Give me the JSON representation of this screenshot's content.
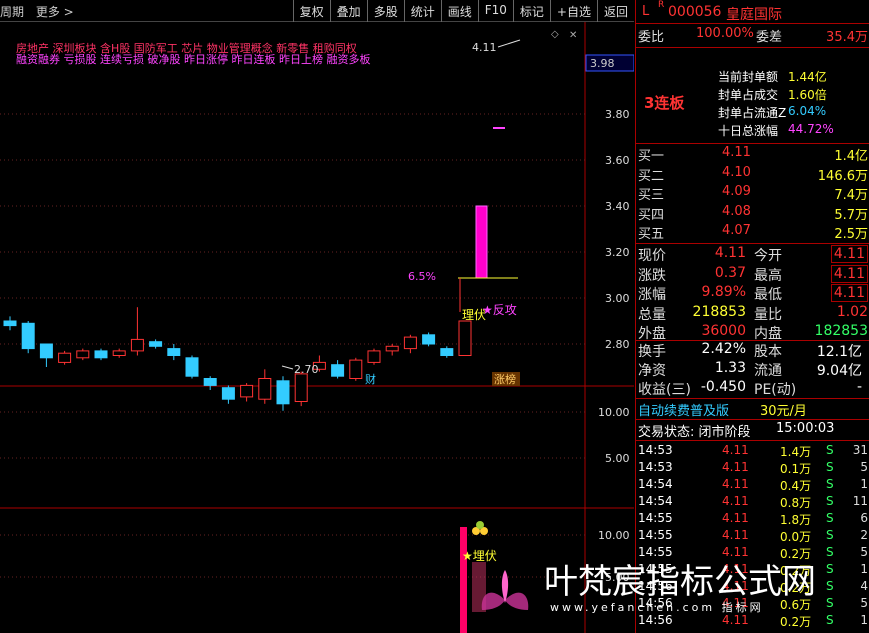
{
  "toolbar": {
    "left_items": [
      "周期",
      "更多 >"
    ],
    "buttons": [
      "复权",
      "叠加",
      "多股",
      "统计",
      "画线",
      "F10",
      "标记",
      "+自选",
      "返回"
    ]
  },
  "chart": {
    "concepts_line1": "房地产   深圳板块 含H股 国防军工 芯片 物业管理概念 新零售 租购同权",
    "concepts_line2": "融资融券 亏损股 连续亏损 破净股 昨日涨停 昨日连板 昨日上榜 融资多板",
    "price_scale": [
      "3.98",
      "3.80",
      "3.60",
      "3.40",
      "3.20",
      "3.00",
      "2.80"
    ],
    "high_label": "4.11",
    "low_label": "2.70",
    "pct_label": "6.5%",
    "signal_buy": "理伏",
    "signal_fangong": "★反攻",
    "tag_cai": "财",
    "tag_zhangbang": "涨榜",
    "vol_scale": [
      "10.00",
      "5.00"
    ],
    "ind_scale": [
      "10.00",
      "5.00"
    ],
    "ind_signal": "★埋伏",
    "candles": [
      {
        "o": 3.1,
        "c": 3.08,
        "h": 3.12,
        "l": 3.06
      },
      {
        "o": 3.09,
        "c": 2.98,
        "h": 3.1,
        "l": 2.96
      },
      {
        "o": 3.0,
        "c": 2.94,
        "h": 3.0,
        "l": 2.9
      },
      {
        "o": 2.92,
        "c": 2.96,
        "h": 2.97,
        "l": 2.91
      },
      {
        "o": 2.94,
        "c": 2.97,
        "h": 2.98,
        "l": 2.93
      },
      {
        "o": 2.97,
        "c": 2.94,
        "h": 2.98,
        "l": 2.93
      },
      {
        "o": 2.95,
        "c": 2.97,
        "h": 2.98,
        "l": 2.94
      },
      {
        "o": 2.97,
        "c": 3.02,
        "h": 3.16,
        "l": 2.95
      },
      {
        "o": 3.01,
        "c": 2.99,
        "h": 3.02,
        "l": 2.98
      },
      {
        "o": 2.98,
        "c": 2.95,
        "h": 3.0,
        "l": 2.93
      },
      {
        "o": 2.94,
        "c": 2.86,
        "h": 2.95,
        "l": 2.85
      },
      {
        "o": 2.85,
        "c": 2.82,
        "h": 2.86,
        "l": 2.8
      },
      {
        "o": 2.81,
        "c": 2.76,
        "h": 2.82,
        "l": 2.74
      },
      {
        "o": 2.77,
        "c": 2.82,
        "h": 2.83,
        "l": 2.75
      },
      {
        "o": 2.76,
        "c": 2.85,
        "h": 2.89,
        "l": 2.74
      },
      {
        "o": 2.84,
        "c": 2.74,
        "h": 2.86,
        "l": 2.71
      },
      {
        "o": 2.75,
        "c": 2.87,
        "h": 2.88,
        "l": 2.73
      },
      {
        "o": 2.89,
        "c": 2.92,
        "h": 2.95,
        "l": 2.88
      },
      {
        "o": 2.91,
        "c": 2.86,
        "h": 2.93,
        "l": 2.85
      },
      {
        "o": 2.85,
        "c": 2.93,
        "h": 2.94,
        "l": 2.84
      },
      {
        "o": 2.92,
        "c": 2.97,
        "h": 2.98,
        "l": 2.91
      },
      {
        "o": 2.97,
        "c": 2.99,
        "h": 3.0,
        "l": 2.95
      },
      {
        "o": 2.98,
        "c": 3.03,
        "h": 3.04,
        "l": 2.96
      },
      {
        "o": 3.04,
        "c": 3.0,
        "h": 3.05,
        "l": 2.99
      },
      {
        "o": 2.98,
        "c": 2.95,
        "h": 2.99,
        "l": 2.94
      },
      {
        "o": 2.95,
        "c": 3.1,
        "h": 3.1,
        "l": 2.95
      },
      {
        "o": 3.1,
        "c": 3.4,
        "h": 3.4,
        "l": 3.1
      }
    ]
  },
  "side": {
    "flag": "L",
    "flag_r": "R",
    "code": "000056",
    "name": "皇庭国际",
    "weibi_label": "委比",
    "weibi_value": "100.00%",
    "weicha_label": "委差",
    "weicha_value": "35.4万",
    "lianban": "3连板",
    "seal_rows": [
      {
        "label": "当前封单额",
        "value": "1.44亿"
      },
      {
        "label": "封单占成交",
        "value": "1.60倍"
      },
      {
        "label": "封单占流通Z",
        "value": "6.04%"
      },
      {
        "label": "十日总涨幅",
        "value": "44.72%"
      }
    ],
    "buys": [
      {
        "label": "买一",
        "price": "4.11",
        "vol": "1.4亿"
      },
      {
        "label": "买二",
        "price": "4.10",
        "vol": "146.6万"
      },
      {
        "label": "买三",
        "price": "4.09",
        "vol": "7.4万"
      },
      {
        "label": "买四",
        "price": "4.08",
        "vol": "5.7万"
      },
      {
        "label": "买五",
        "price": "4.07",
        "vol": "2.5万"
      }
    ],
    "quote": [
      {
        "l1": "现价",
        "v1": "4.11",
        "l2": "今开",
        "v2": "4.11"
      },
      {
        "l1": "涨跌",
        "v1": "0.37",
        "l2": "最高",
        "v2": "4.11"
      },
      {
        "l1": "涨幅",
        "v1": "9.89%",
        "l2": "最低",
        "v2": "4.11"
      },
      {
        "l1": "总量",
        "v1": "218853",
        "l2": "量比",
        "v2": "1.02"
      },
      {
        "l1": "外盘",
        "v1": "36000",
        "l2": "内盘",
        "v2": "182853"
      }
    ],
    "fund": [
      {
        "l1": "换手",
        "v1": "2.42%",
        "l2": "股本",
        "v2": "12.1亿"
      },
      {
        "l1": "净资",
        "v1": "1.33",
        "l2": "流通",
        "v2": "9.04亿"
      },
      {
        "l1": "收益(三)",
        "v1": "-0.450",
        "l2": "PE(动)",
        "v2": "-"
      }
    ],
    "promo": "自动续费普及版",
    "promo_price": "30元/月",
    "status_label": "交易状态: 闭市阶段",
    "status_time": "15:00:03",
    "ticks": [
      {
        "t": "14:53",
        "p": "4.11",
        "v": "1.4万",
        "s": "S",
        "n": "31"
      },
      {
        "t": "14:53",
        "p": "4.11",
        "v": "0.1万",
        "s": "S",
        "n": "5"
      },
      {
        "t": "14:54",
        "p": "4.11",
        "v": "0.4万",
        "s": "S",
        "n": "1"
      },
      {
        "t": "14:54",
        "p": "4.11",
        "v": "0.8万",
        "s": "S",
        "n": "11"
      },
      {
        "t": "14:55",
        "p": "4.11",
        "v": "1.8万",
        "s": "S",
        "n": "6"
      },
      {
        "t": "14:55",
        "p": "4.11",
        "v": "0.0万",
        "s": "S",
        "n": "2"
      },
      {
        "t": "14:55",
        "p": "4.11",
        "v": "0.2万",
        "s": "S",
        "n": "5"
      },
      {
        "t": "14:55",
        "p": "4.11",
        "v": "0.2万",
        "s": "S",
        "n": "1"
      },
      {
        "t": "14:56",
        "p": "4.11",
        "v": "0.2万",
        "s": "S",
        "n": "4"
      },
      {
        "t": "14:56",
        "p": "4.11",
        "v": "0.6万",
        "s": "S",
        "n": "5"
      },
      {
        "t": "14:56",
        "p": "4.11",
        "v": "0.2万",
        "s": "S",
        "n": "1"
      }
    ]
  },
  "watermark": {
    "title": "叶梵宸指标公式网",
    "url": "www.yefanchen.com 指标网"
  }
}
